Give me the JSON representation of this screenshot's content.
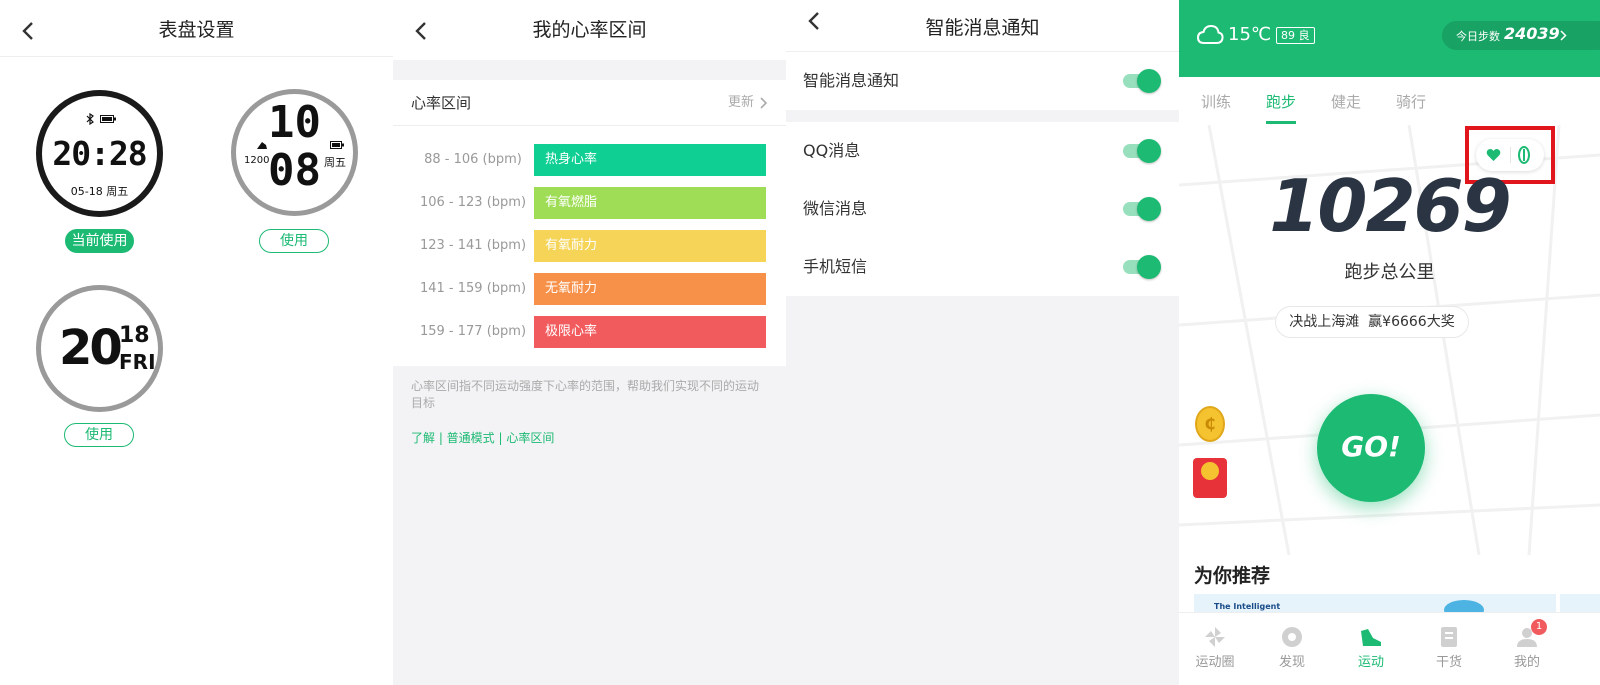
{
  "watchface_screen": {
    "title": "表盘设置",
    "faces": [
      {
        "time": "20:28",
        "date": "05-18",
        "weekday": "周五",
        "button": "当前使用"
      },
      {
        "hour": "10",
        "minute": "08",
        "steps": "1200",
        "weekday": "周五",
        "button": "使用"
      },
      {
        "hour": "20",
        "day": "18",
        "weekday_en": "FRI",
        "button": "使用"
      }
    ]
  },
  "heart_rate_screen": {
    "title": "我的心率区间",
    "section_label": "心率区间",
    "update_label": "更新",
    "zones": [
      {
        "range": "88 - 106 (bpm)",
        "label": "热身心率",
        "color": "#0fcf93"
      },
      {
        "range": "106 - 123 (bpm)",
        "label": "有氧燃脂",
        "color": "#9edd55"
      },
      {
        "range": "123 - 141 (bpm)",
        "label": "有氧耐力",
        "color": "#f5d458"
      },
      {
        "range": "141 - 159 (bpm)",
        "label": "无氧耐力",
        "color": "#f7914a"
      },
      {
        "range": "159 - 177 (bpm)",
        "label": "极限心率",
        "color": "#f25b5e"
      }
    ],
    "description": "心率区间指不同运动强度下心率的范围，帮助我们实现不同的运动目标",
    "link": "了解 | 普通模式 | 心率区间"
  },
  "notification_screen": {
    "title": "智能消息通知",
    "master": {
      "label": "智能消息通知",
      "on": true
    },
    "items": [
      {
        "label": "QQ消息",
        "on": true
      },
      {
        "label": "微信消息",
        "on": true
      },
      {
        "label": "手机短信",
        "on": true
      }
    ]
  },
  "sport_screen": {
    "weather_temp": "15℃",
    "aqi": "89 良",
    "steps_label": "今日步数",
    "steps_value": "24039",
    "tabs": [
      "训练",
      "跑步",
      "健走",
      "骑行"
    ],
    "active_tab": "跑步",
    "total_value": "10269",
    "total_label": "跑步总公里",
    "promo": "决战上海滩  赢¥6666大奖",
    "go_label": "GO!",
    "recommend_title": "为你推荐",
    "banner_text": "The Intelligent",
    "nav": [
      {
        "label": "运动圈",
        "active": false
      },
      {
        "label": "发现",
        "active": false
      },
      {
        "label": "运动",
        "active": true
      },
      {
        "label": "干货",
        "active": false
      },
      {
        "label": "我的",
        "active": false,
        "badge": "1"
      }
    ],
    "colors": {
      "accent": "#1cba73",
      "highlight_box": "#e0161c"
    }
  }
}
